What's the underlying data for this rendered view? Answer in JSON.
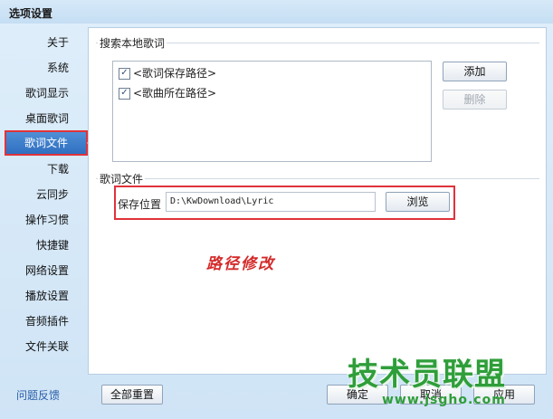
{
  "window": {
    "title": "选项设置"
  },
  "sidebar": {
    "items": [
      {
        "label": "关于"
      },
      {
        "label": "系统"
      },
      {
        "label": "歌词显示"
      },
      {
        "label": "桌面歌词"
      },
      {
        "label": "歌词文件",
        "active": true
      },
      {
        "label": "下载"
      },
      {
        "label": "云同步"
      },
      {
        "label": "操作习惯"
      },
      {
        "label": "快捷键"
      },
      {
        "label": "网络设置"
      },
      {
        "label": "播放设置"
      },
      {
        "label": "音频插件"
      },
      {
        "label": "文件关联"
      }
    ],
    "feedback": "问题反馈"
  },
  "search_section": {
    "title": "搜索本地歌词",
    "paths": [
      {
        "label": "<歌词保存路径>",
        "checked": true
      },
      {
        "label": "<歌曲所在路径>",
        "checked": true
      }
    ],
    "add_label": "添加",
    "delete_label": "删除"
  },
  "lyric_file_section": {
    "title": "歌词文件",
    "save_label": "保存位置",
    "path_value": "D:\\KwDownload\\Lyric",
    "browse_label": "浏览"
  },
  "annotation": "路径修改",
  "footer": {
    "reset_label": "全部重置",
    "ok_label": "确定",
    "cancel_label": "取消",
    "apply_label": "应用"
  },
  "watermark": {
    "main": "技术员联盟",
    "sub": "www.jsgho.com"
  },
  "colors": {
    "highlight": "#e0323a",
    "nav_active": "#3a7bcc",
    "watermark": "#2f9e3a"
  }
}
